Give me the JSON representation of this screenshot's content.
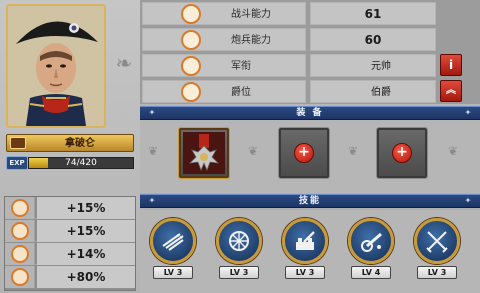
{
  "hero": {
    "name": "拿破仑",
    "exp_tag": "EXP",
    "exp_text": "74/420",
    "exp_fill_fraction": 0.18
  },
  "bonuses": [
    {
      "icon": "swords-icon",
      "value": "+15%"
    },
    {
      "icon": "cannon-icon",
      "value": "+15%"
    },
    {
      "icon": "shield-icon",
      "value": "+14%"
    },
    {
      "icon": "heart-icon",
      "value": "+80%"
    }
  ],
  "stats": {
    "combat": {
      "label": "战斗能力",
      "value": "61",
      "icon": "crossed-swords-icon"
    },
    "artillery": {
      "label": "炮兵能力",
      "value": "60",
      "icon": "cannon-icon"
    },
    "rank": {
      "label": "军衔",
      "value": "元帅",
      "icon": "rank-badge-icon",
      "emblem": "eagle-emblem-icon",
      "button": "i"
    },
    "title": {
      "label": "爵位",
      "value": "伯爵",
      "icon": "crown-icon",
      "emblem": "helmet-emblem-icon",
      "button": "^"
    }
  },
  "sections": {
    "equipment": "装 备",
    "skills": "技能"
  },
  "equipment": [
    {
      "state": "filled",
      "item": "medal"
    },
    {
      "state": "empty",
      "plus": "+"
    },
    {
      "state": "empty",
      "plus": "+"
    }
  ],
  "skills": [
    {
      "icon": "arrows-icon",
      "level": "LV 3"
    },
    {
      "icon": "cannon-wheel-icon",
      "level": "LV 3"
    },
    {
      "icon": "fortress-cannon-icon",
      "level": "LV 3"
    },
    {
      "icon": "artillery-icon",
      "level": "LV 4"
    },
    {
      "icon": "crossed-sabres-icon",
      "level": "LV 3"
    }
  ],
  "colors": {
    "accent_gold": "#c79a3a",
    "header_blue": "#1d3566",
    "button_red": "#c42a1a"
  }
}
